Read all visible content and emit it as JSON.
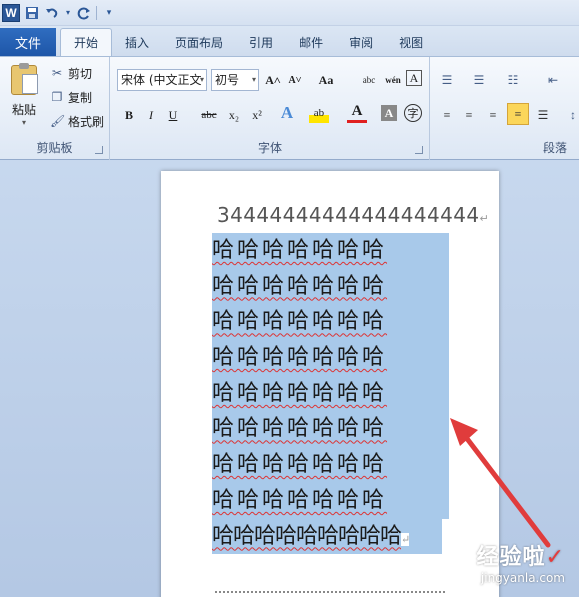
{
  "app": {
    "logo_letter": "W",
    "quick_access": [
      "save-icon",
      "undo-icon",
      "redo-icon",
      "customize-icon"
    ]
  },
  "tabs": {
    "file": "文件",
    "items": [
      "开始",
      "插入",
      "页面布局",
      "引用",
      "邮件",
      "审阅",
      "视图"
    ],
    "active_index": 0
  },
  "ribbon": {
    "clipboard": {
      "label": "剪贴板",
      "paste": "粘贴",
      "cut": "剪切",
      "copy": "复制",
      "format_painter": "格式刷"
    },
    "font": {
      "label": "字体",
      "font_name": "宋体 (中文正文",
      "font_size": "初号",
      "buttons": [
        "A˄",
        "A˅",
        "Aa",
        "abc",
        "wén",
        "A",
        "B",
        "I",
        "U",
        "abc",
        "x₂",
        "x²",
        "A",
        "ab",
        "A",
        "A",
        "字"
      ]
    },
    "paragraph": {
      "label": "段落"
    }
  },
  "document": {
    "line1": "34444444444444444444",
    "ha_lines": [
      "哈哈哈哈哈哈哈",
      "哈哈哈哈哈哈哈",
      "哈哈哈哈哈哈哈",
      "哈哈哈哈哈哈哈",
      "哈哈哈哈哈哈哈",
      "哈哈哈哈哈哈哈",
      "哈哈哈哈哈哈哈",
      "哈哈哈哈哈哈哈",
      "哈哈哈哈哈哈哈哈哈"
    ],
    "paragraph_mark": "↵"
  },
  "watermark": {
    "main": "经验啦",
    "check": "✓",
    "sub": "jingyanla.com"
  },
  "colors": {
    "selection": "#a8c9ea",
    "arrow": "#e03c3c",
    "file_tab": "#2b66b8"
  }
}
